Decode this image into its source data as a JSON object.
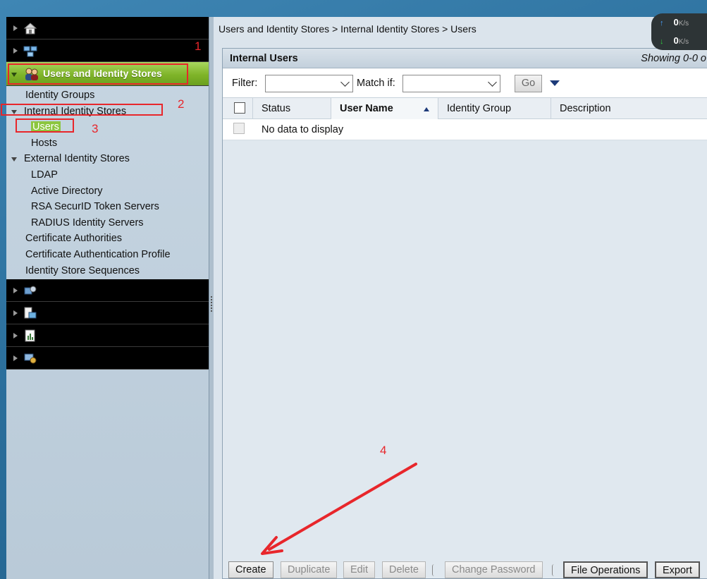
{
  "sidebar": {
    "active_drawer_title": "Users and Identity Stores",
    "items": [
      {
        "label": "Identity Groups",
        "level": "l1"
      },
      {
        "label": "Internal Identity Stores",
        "level": "l1t",
        "expanded": true
      },
      {
        "label": "Users",
        "level": "l2",
        "selected": true
      },
      {
        "label": "Hosts",
        "level": "l2"
      },
      {
        "label": "External Identity Stores",
        "level": "l1t",
        "expanded": true
      },
      {
        "label": "LDAP",
        "level": "l2"
      },
      {
        "label": "Active Directory",
        "level": "l2"
      },
      {
        "label": "RSA SecurID Token Servers",
        "level": "l2"
      },
      {
        "label": "RADIUS Identity Servers",
        "level": "l2"
      },
      {
        "label": "Certificate Authorities",
        "level": "l1"
      },
      {
        "label": "Certificate Authentication Profile",
        "level": "l1"
      },
      {
        "label": "Identity Store Sequences",
        "level": "l1"
      }
    ],
    "drawer_icons": [
      "home-icon",
      "network-resources-icon",
      "users-icon",
      "policy-elements-icon",
      "access-policies-icon",
      "monitoring-reports-icon",
      "system-administration-icon"
    ]
  },
  "breadcrumb": "Users and Identity Stores > Internal Identity Stores > Users",
  "panel": {
    "title": "Internal Users",
    "count_text": "Showing 0-0 o"
  },
  "filter": {
    "filter_label": "Filter:",
    "match_label": "Match if:",
    "go_label": "Go"
  },
  "grid": {
    "columns": [
      "Status",
      "User Name",
      "Identity Group",
      "Description"
    ],
    "sorted_column": "User Name",
    "empty_message": "No data to display"
  },
  "toolbar": {
    "create": "Create",
    "duplicate": "Duplicate",
    "edit": "Edit",
    "delete": "Delete",
    "change_password": "Change Password",
    "file_operations": "File Operations",
    "export": "Export"
  },
  "net_widget": {
    "up_value": "0",
    "up_unit": "K/s",
    "down_value": "0",
    "down_unit": "K/s"
  },
  "annotations": {
    "n1": "1",
    "n2": "2",
    "n3": "3",
    "n4": "4",
    "color": "#e8262b"
  },
  "colors": {
    "accent_green": "#8cc63f",
    "sort_blue": "#1d3a79"
  }
}
